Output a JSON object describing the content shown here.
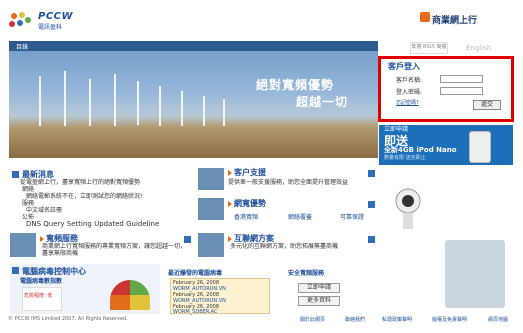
{
  "header": {
    "brand": "PCCW",
    "brand_sub": "電訊盈科",
    "biz_link": "商業網上行"
  },
  "hero": {
    "tab_title": "目錄",
    "slogan_line1": "絕對寬頻優勢",
    "slogan_line2": "超越一切"
  },
  "lang": {
    "zh": "繁體 BIG5 簡體",
    "en": "English"
  },
  "login": {
    "title": "客戶登入",
    "user_label": "客戶名稱:",
    "pass_label": "登入密碼:",
    "forgot": "忘記密碼?",
    "submit": "遞交"
  },
  "promo": {
    "line1": "立即申請",
    "line2": "即送",
    "line3": "全新4GB iPod Nano",
    "line4": "數量有限‧送完即止"
  },
  "news": {
    "title": "最新消息",
    "items": [
      "從電盈網上行，盡享寬頻上行的絕對寬頻優勢",
      "網絡",
      "網絡電郵系統不在，立即測試您的網絡狀況!",
      "服務",
      "中文域名註冊",
      "公佈",
      "DNS Query Setting Updated Guideline"
    ]
  },
  "support": {
    "title": "客户支援",
    "text": "提供車一般支援服務，助您全面提升管理效益"
  },
  "promo_sec": {
    "title": "網寬優勢",
    "links": [
      "香港寬頻",
      "網絡覆蓋",
      "可靠保證"
    ]
  },
  "broadband": {
    "title": "寬頻服務",
    "text": "商業網上行寬頻服務的專業寬頻方案，讓您超越一切，盡享無限商機"
  },
  "interactive": {
    "title": "互聯網方案",
    "text": "多元化的互聯網方案，助您拓展無盡商機"
  },
  "virus": {
    "title": "電腦病毒控制中心",
    "subtitle": "電腦病毒數指數",
    "risk": "危險程度: 低",
    "latest": "最近爆發的電腦病毒",
    "entries": [
      {
        "date": "February 26, 2008",
        "name": "WORM_AUTORUN.VN"
      },
      {
        "date": "February 26, 2008",
        "name": "WORM_AUTORUN.VN"
      },
      {
        "date": "February 26, 2008",
        "name": "WORM_SDBER.AC"
      }
    ]
  },
  "security": {
    "title": "安全寬頻服務",
    "btn1": "立即申請",
    "btn2": "更多資料"
  },
  "footer": {
    "copyright": "© PCCW IMS Limited 2007. All Rights Reserved.",
    "links": [
      "關於此網頁",
      "聯絡我們",
      "私隱政策聲明",
      "版權及免責聲明",
      "網頁地圖"
    ]
  },
  "colors": {
    "brand_blue": "#1d4e99",
    "alert_red": "#e00000",
    "accent_orange": "#e36b1c"
  }
}
